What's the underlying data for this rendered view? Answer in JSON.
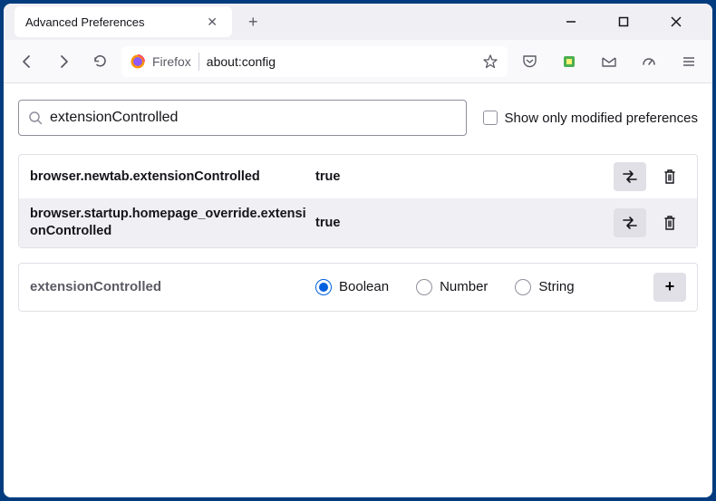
{
  "titlebar": {
    "tab_title": "Advanced Preferences"
  },
  "toolbar": {
    "firefox_label": "Firefox",
    "url": "about:config"
  },
  "search": {
    "value": "extensionControlled",
    "checkbox_label": "Show only modified preferences"
  },
  "prefs": [
    {
      "name": "browser.newtab.extensionControlled",
      "value": "true"
    },
    {
      "name": "browser.startup.homepage_override.extensionControlled",
      "value": "true"
    }
  ],
  "new_pref": {
    "name": "extensionControlled",
    "options": [
      "Boolean",
      "Number",
      "String"
    ],
    "selected": "Boolean"
  }
}
